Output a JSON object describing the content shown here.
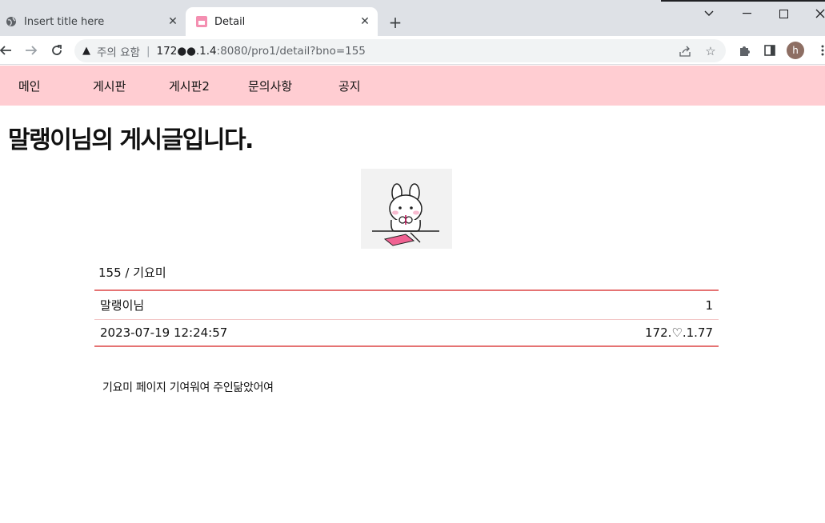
{
  "browser": {
    "tabs": [
      {
        "title": "Insert title here",
        "favicon": "globe-icon",
        "active": false
      },
      {
        "title": "Detail",
        "favicon": "pink-page-icon",
        "active": true
      }
    ],
    "address": {
      "security_text": "주의 요함",
      "url_host": "172",
      "url_masked": "●●",
      "url_host_rest": ".1.4",
      "url_path": ":8080/pro1/detail?bno=155"
    },
    "profile_initial": "h"
  },
  "site_nav": {
    "items": [
      "메인",
      "게시판",
      "게시판2",
      "문의사항",
      "공지"
    ]
  },
  "post": {
    "heading": "말랭이님의 게시글입니다.",
    "meta": "155 / 기요미",
    "author": "말랭이님",
    "count": "1",
    "datetime": "2023-07-19 12:24:57",
    "ip": "172.♡.1.77",
    "content": "기요미 페이지 기여워여 주인닮았어여"
  },
  "colors": {
    "nav_bg": "#ffcdd2",
    "table_border": "#e57373"
  }
}
